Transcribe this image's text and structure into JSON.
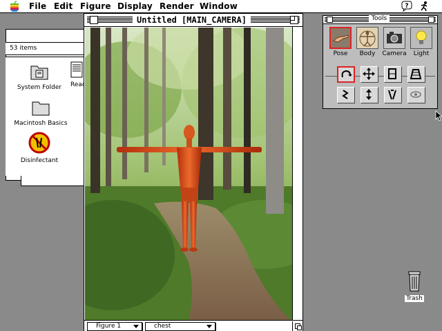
{
  "menubar": {
    "apple_icon": "apple-icon",
    "items": [
      "File",
      "Edit",
      "Figure",
      "Display",
      "Render",
      "Window"
    ],
    "help_icon": "help-balloon-icon",
    "app_icon": "poser-running-figure-icon"
  },
  "finder": {
    "items_count": "53 items",
    "icons": [
      {
        "label": "System Folder",
        "icon": "system-folder-icon"
      },
      {
        "label": "Read",
        "icon": "document-icon"
      },
      {
        "label": "Macintosh Basics",
        "icon": "folder-icon"
      },
      {
        "label": "Disinfectant",
        "icon": "disinfectant-app-icon"
      }
    ]
  },
  "document": {
    "title": "Untitled [MAIN_CAMERA]",
    "figure_menu": "Figure 1",
    "body_part_menu": "chest"
  },
  "tools": {
    "title": "Tools",
    "modes": [
      {
        "label": "Pose",
        "icon": "hand-pose-icon",
        "selected": true
      },
      {
        "label": "Body",
        "icon": "vitruvian-body-icon",
        "selected": false
      },
      {
        "label": "Camera",
        "icon": "camera-icon",
        "selected": false
      },
      {
        "label": "Light",
        "icon": "lightbulb-icon",
        "selected": false
      }
    ],
    "editing_tools": [
      {
        "icon": "rotate-icon",
        "selected": true
      },
      {
        "icon": "translate-icon",
        "selected": false
      },
      {
        "icon": "twist-icon",
        "selected": false
      },
      {
        "icon": "taper-icon",
        "selected": false
      },
      {
        "icon": "chain-break-icon",
        "selected": false
      },
      {
        "icon": "scale-icon",
        "selected": false
      },
      {
        "icon": "color-icon",
        "selected": false
      },
      {
        "icon": "view-magnifier-icon",
        "selected": false
      }
    ]
  },
  "trash": {
    "label": "Trash",
    "icon": "trash-icon"
  },
  "colors": {
    "selected_outline": "#dd2222",
    "figure": "#e0561c",
    "desktop": "#8a8a8a"
  }
}
